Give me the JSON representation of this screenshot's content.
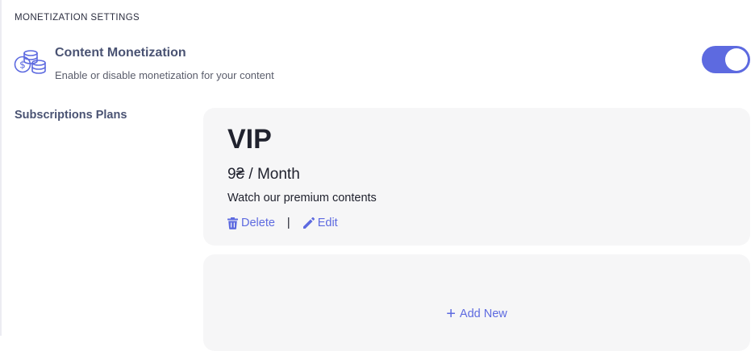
{
  "section_title": "MONETIZATION SETTINGS",
  "monetization": {
    "title": "Content Monetization",
    "subtitle": "Enable or disable monetization for your content",
    "enabled": true,
    "icon": "coins-icon"
  },
  "subscriptions": {
    "label": "Subscriptions Plans",
    "plans": [
      {
        "name": "VIP",
        "price": "9₴ / Month",
        "description": "Watch our premium contents",
        "delete_label": "Delete",
        "separator": "|",
        "edit_label": "Edit"
      }
    ],
    "add_new_label": "Add New"
  },
  "colors": {
    "accent": "#5d6ae0",
    "card_bg": "#f6f6f7",
    "heading": "#4a5373"
  }
}
